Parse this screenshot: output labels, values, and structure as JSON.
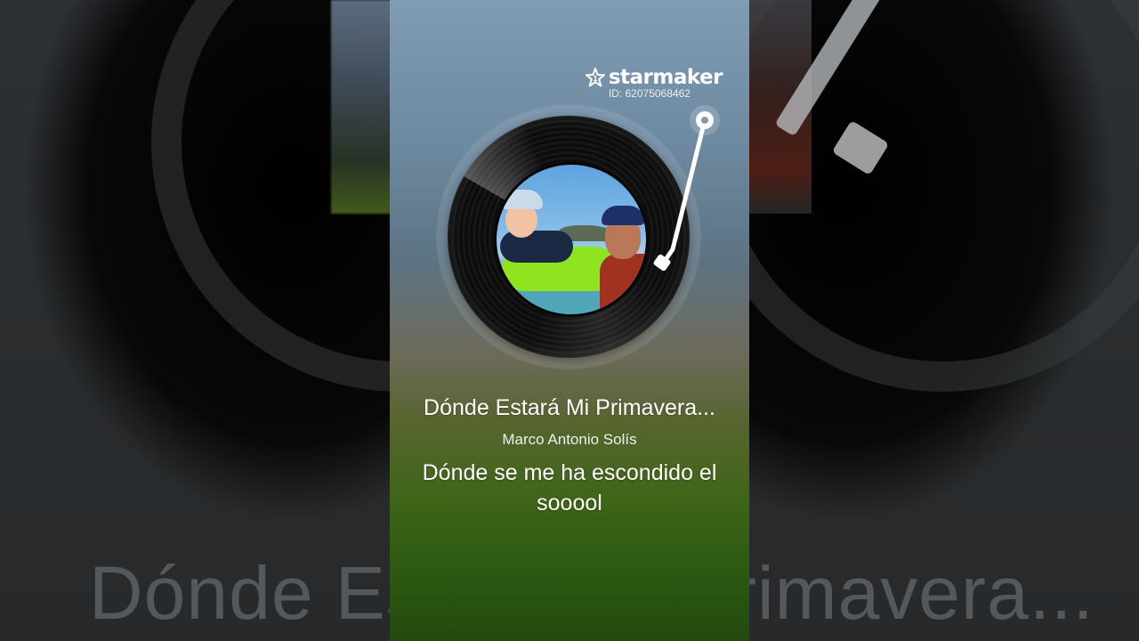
{
  "brand": {
    "name": "starmaker",
    "id_text": "ID: 62075068462",
    "icon": "star-icon"
  },
  "song": {
    "title": "Dónde Estará Mi Primavera...",
    "artist": "Marco Antonio Solís"
  },
  "lyrics": {
    "current_line": "Dónde se me ha escondido el sooool"
  },
  "background": {
    "title_echo": "Dónde Estará Mi Primavera..."
  },
  "colors": {
    "text": "#ffffff",
    "record": "#111111",
    "tonearm": "#ffffff"
  }
}
